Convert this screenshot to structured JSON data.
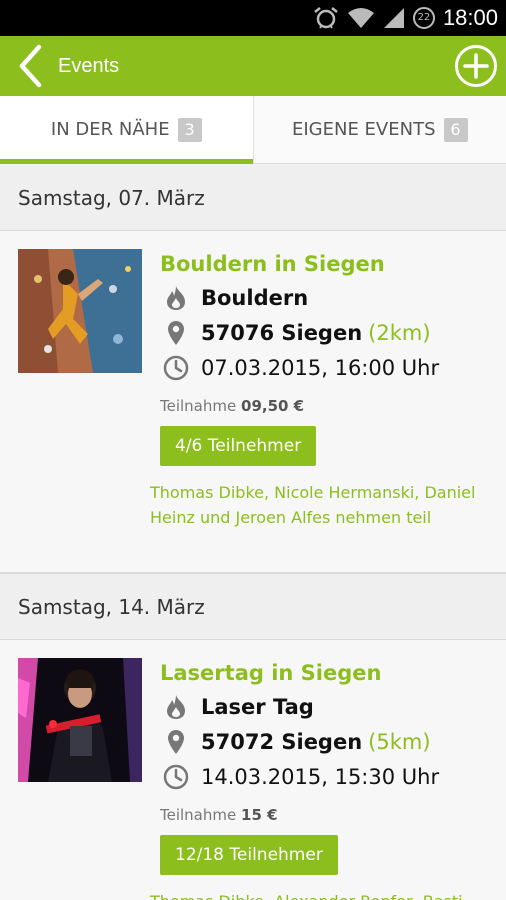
{
  "status_bar": {
    "time": "18:00",
    "notification_count": "22"
  },
  "app_bar": {
    "title": "Events"
  },
  "tabs": [
    {
      "label": "IN DER NÄHE",
      "count": "3"
    },
    {
      "label": "EIGENE EVENTS",
      "count": "6"
    }
  ],
  "sections": [
    {
      "date": "Samstag, 07. März",
      "event": {
        "title": "Bouldern in Siegen",
        "category": "Bouldern",
        "location": "57076 Siegen",
        "distance": "(2km)",
        "datetime": "07.03.2015, 16:00 Uhr",
        "fee_label": "Teilnahme",
        "fee_value": "09,50 €",
        "participants": "4/6 Teilnehmer",
        "attendees": "Thomas Dibke, Nicole Hermanski, Daniel Heinz und Jeroen Alfes nehmen teil"
      }
    },
    {
      "date": "Samstag, 14. März",
      "event": {
        "title": "Lasertag in Siegen",
        "category": "Laser Tag",
        "location": "57072 Siegen",
        "distance": "(5km)",
        "datetime": "14.03.2015, 15:30 Uhr",
        "fee_label": "Teilnahme",
        "fee_value": "15 €",
        "participants": "12/18 Teilnehmer",
        "attendees": "Thomas Dibke, Alexander Ronfer, Basti"
      }
    }
  ],
  "colors": {
    "accent": "#8cbe1e",
    "status_bar": "#000000",
    "badge": "#c8c8c8"
  },
  "icons": [
    "back-arrow-icon",
    "add-circle-icon",
    "flame-icon",
    "location-pin-icon",
    "clock-icon",
    "alarm-icon",
    "wifi-icon",
    "signal-icon"
  ]
}
